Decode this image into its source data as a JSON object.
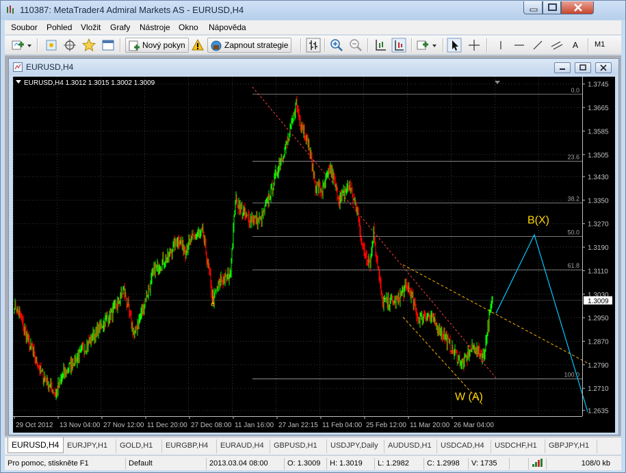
{
  "window": {
    "title": "110387: MetaTrader4 Admiral Markets AS - EURUSD,H4"
  },
  "menu": [
    "Soubor",
    "Pohled",
    "Vložit",
    "Grafy",
    "Nástroje",
    "Okno",
    "Nápověda"
  ],
  "toolbar": {
    "new_order": "Nový pokyn",
    "autotrading": "Zapnout strategie",
    "text_tool": "A",
    "timeframe": "M1"
  },
  "child": {
    "title": "EURUSD,H4"
  },
  "chart_data": {
    "type": "candlestick",
    "symbol_label": "EURUSD,H4",
    "ohlc_label": "1.3012 1.3015 1.3002 1.3009",
    "background": "#000000",
    "colors": {
      "bull": "#00ff00",
      "bear": "#ff0000",
      "grid": "#3a3a3a",
      "axis": "#c0c0c0",
      "fib": "#a0a0a0",
      "channel": "#ff4040",
      "trend": "#ffb400",
      "projection": "#00c8ff",
      "label": "#ffd800",
      "current_price_box": "#ffffff"
    },
    "y_ticks": [
      "1.3745",
      "1.3665",
      "1.3585",
      "1.3505",
      "1.3430",
      "1.3350",
      "1.3270",
      "1.3190",
      "1.3110",
      "1.3030",
      "1.2950",
      "1.2870",
      "1.2790",
      "1.2710",
      "1.2635"
    ],
    "y_tick_values": [
      1.3745,
      1.3665,
      1.3585,
      1.3505,
      1.343,
      1.335,
      1.327,
      1.319,
      1.311,
      1.303,
      1.295,
      1.287,
      1.279,
      1.271,
      1.2635
    ],
    "ylim": [
      1.2615,
      1.377
    ],
    "current_price": {
      "value": 1.3009,
      "label": "1.3009"
    },
    "x_ticks": [
      "29 Oct 2012",
      "13 Nov 04:00",
      "27 Nov 12:00",
      "11 Dec 20:00",
      "27 Dec 08:00",
      "11 Jan 16:00",
      "27 Jan 22:15",
      "11 Feb 04:00",
      "25 Feb 12:00",
      "11 Mar 20:00",
      "26 Mar 04:00"
    ],
    "x_tick_bars": [
      0,
      64,
      128,
      192,
      256,
      320,
      384,
      448,
      512,
      576,
      640
    ],
    "bar_count": 700,
    "projection_bar_span": 140,
    "anchor_prices": [
      [
        0,
        1.2995
      ],
      [
        8,
        1.296
      ],
      [
        20,
        1.287
      ],
      [
        40,
        1.276
      ],
      [
        60,
        1.269
      ],
      [
        72,
        1.276
      ],
      [
        90,
        1.281
      ],
      [
        110,
        1.287
      ],
      [
        130,
        1.293
      ],
      [
        150,
        1.299
      ],
      [
        160,
        1.305
      ],
      [
        175,
        1.289
      ],
      [
        190,
        1.3
      ],
      [
        205,
        1.311
      ],
      [
        225,
        1.316
      ],
      [
        240,
        1.322
      ],
      [
        250,
        1.318
      ],
      [
        260,
        1.322
      ],
      [
        275,
        1.324
      ],
      [
        285,
        1.31
      ],
      [
        290,
        1.301
      ],
      [
        302,
        1.308
      ],
      [
        315,
        1.309
      ],
      [
        323,
        1.335
      ],
      [
        340,
        1.329
      ],
      [
        360,
        1.328
      ],
      [
        375,
        1.338
      ],
      [
        385,
        1.346
      ],
      [
        400,
        1.355
      ],
      [
        412,
        1.368
      ],
      [
        418,
        1.362
      ],
      [
        430,
        1.354
      ],
      [
        440,
        1.34
      ],
      [
        450,
        1.338
      ],
      [
        462,
        1.346
      ],
      [
        475,
        1.335
      ],
      [
        490,
        1.34
      ],
      [
        502,
        1.33
      ],
      [
        510,
        1.318
      ],
      [
        520,
        1.314
      ],
      [
        525,
        1.324
      ],
      [
        538,
        1.3
      ],
      [
        560,
        1.301
      ],
      [
        575,
        1.306
      ],
      [
        590,
        1.295
      ],
      [
        605,
        1.296
      ],
      [
        625,
        1.29
      ],
      [
        640,
        1.284
      ],
      [
        655,
        1.279
      ],
      [
        670,
        1.285
      ],
      [
        686,
        1.282
      ],
      [
        694,
        1.295
      ],
      [
        699,
        1.3009
      ]
    ],
    "fib_levels": [
      {
        "label": "0.0",
        "price": 1.371
      },
      {
        "label": "23.6",
        "price": 1.3482
      },
      {
        "label": "38.2",
        "price": 1.334
      },
      {
        "label": "50.0",
        "price": 1.3226
      },
      {
        "label": "61.8",
        "price": 1.3113
      },
      {
        "label": "100.0",
        "price": 1.2742
      }
    ],
    "fib_start_bar": 348,
    "channel_line": {
      "from": [
        348,
        1.3735
      ],
      "to": [
        704,
        1.2745
      ]
    },
    "upper_trend": {
      "from": [
        568,
        1.313
      ],
      "to": [
        840,
        1.2793
      ]
    },
    "lower_trend": {
      "from": [
        568,
        1.2952
      ],
      "to": [
        686,
        1.265
      ]
    },
    "projection": {
      "points": [
        [
          704,
          1.2965
        ],
        [
          760,
          1.3232
        ],
        [
          838,
          1.263
        ]
      ]
    },
    "marker": {
      "bar": 290,
      "price": 1.2995
    },
    "annotations": [
      {
        "text": "B(X)",
        "bar": 750,
        "price": 1.327
      },
      {
        "text": "W (A)",
        "bar": 644,
        "price": 1.267
      }
    ]
  },
  "tabs": [
    "EURUSD,H4",
    "EURJPY,H1",
    "GOLD,H1",
    "EURGBP,H4",
    "EURAUD,H4",
    "GBPUSD,H1",
    "USDJPY,Daily",
    "AUDUSD,H1",
    "USDCAD,H4",
    "USDCHF,H1",
    "GBPJPY,H1"
  ],
  "status": {
    "help": "Pro pomoc, stiskněte F1",
    "profile": "Default",
    "datetime": "2013.03.04 08:00",
    "open": "O: 1.3009",
    "high": "H: 1.3019",
    "low": "L: 1.2982",
    "close": "C: 1.2998",
    "volume": "V: 1735",
    "traffic": "108/0 kb"
  }
}
